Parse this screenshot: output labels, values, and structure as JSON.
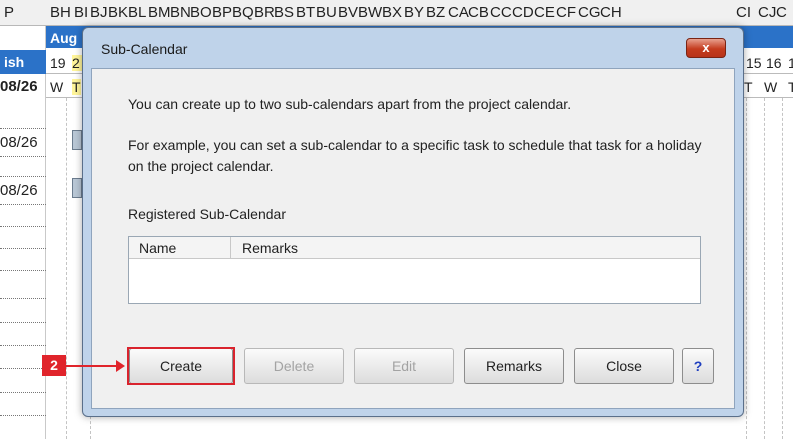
{
  "sheet": {
    "column_letters": [
      "P",
      "BH",
      "BI",
      "BJ",
      "BK",
      "BL",
      "BM",
      "BN",
      "BO",
      "BP",
      "BQ",
      "BR",
      "BS",
      "BT",
      "BU",
      "BV",
      "BW",
      "BX",
      "BY",
      "BZ",
      "CA",
      "CB",
      "CC",
      "CD",
      "CE",
      "CF",
      "CG",
      "CH",
      "CI",
      "CJ",
      "C"
    ],
    "month_label": "Aug",
    "left_header_label": "ish",
    "left_date_header": "08/26",
    "left_task_dates": [
      "08/26",
      "08/26"
    ],
    "day_numbers": [
      "19",
      "2",
      "15",
      "16",
      "1"
    ],
    "weekday_letters": [
      "W",
      "T",
      "T",
      "W",
      "T"
    ]
  },
  "dialog": {
    "title": "Sub-Calendar",
    "close_symbol": "x",
    "message1": "You can create up to two sub-calendars apart from the project calendar.",
    "message2": "For example, you can set a sub-calendar to a specific task to schedule that task for a holiday on the project calendar.",
    "section_label": "Registered Sub-Calendar",
    "table": {
      "columns": [
        "Name",
        "Remarks"
      ],
      "rows": []
    },
    "buttons": {
      "create": "Create",
      "delete": "Delete",
      "edit": "Edit",
      "remarks": "Remarks",
      "close": "Close",
      "help": "?"
    }
  },
  "annotation": {
    "step_number": "2"
  },
  "colors": {
    "header_blue": "#2b72c8",
    "dialog_frame": "#bfd3ea",
    "close_red": "#c43c1e",
    "highlight_red": "#e0242b"
  },
  "icons": {
    "close": "close-icon",
    "help": "help-icon",
    "arrow": "arrow-right-icon"
  }
}
